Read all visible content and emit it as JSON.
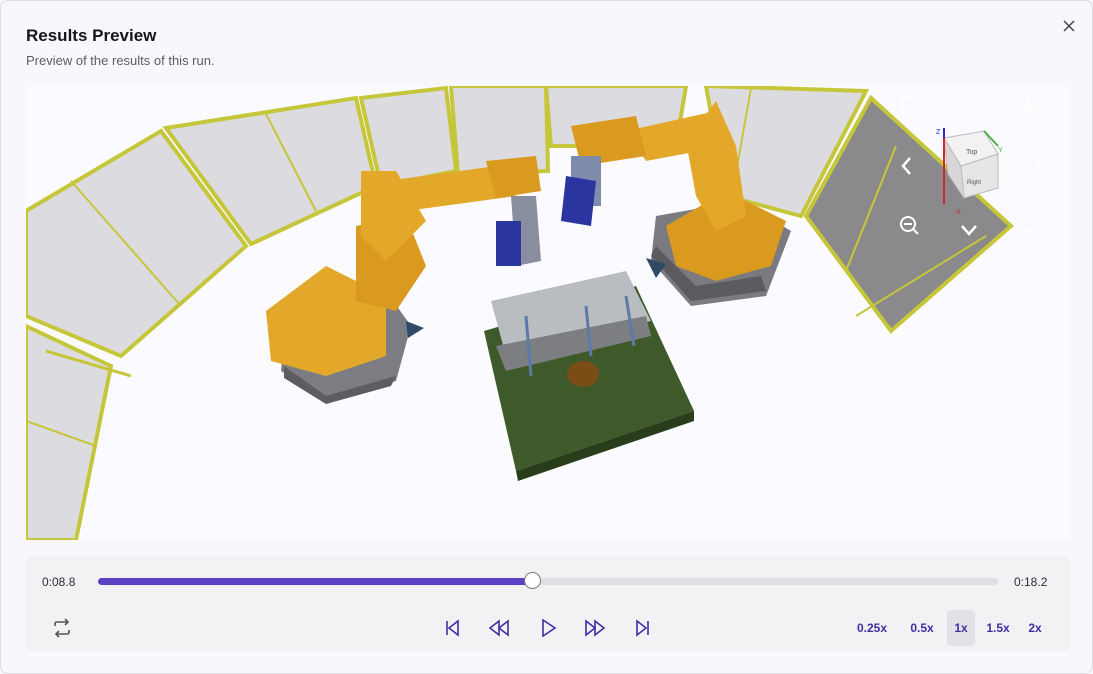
{
  "dialog": {
    "title": "Results Preview",
    "subtitle": "Preview of the results of this run."
  },
  "viewer": {
    "scene": "robot-welding-cell-3d",
    "view_cube": {
      "faces": [
        "Top",
        "Right"
      ],
      "axes": [
        "X",
        "Y",
        "Z"
      ]
    },
    "controls": [
      "camera-icon",
      "chevron-up-icon",
      "move-icon",
      "chevron-left-icon",
      "chevron-right-icon",
      "zoom-out-icon",
      "chevron-down-icon",
      "settings-icon"
    ]
  },
  "playback": {
    "current_time": "0:08.8",
    "total_time": "0:18.2",
    "progress": 0.483,
    "speeds": [
      "0.25x",
      "0.5x",
      "1x",
      "1.5x",
      "2x"
    ],
    "active_speed": "1x"
  },
  "colors": {
    "accent": "#5b3fc4",
    "robot": "#e3a82a",
    "fence": "#c6c63a",
    "table": "#3f5a2a"
  }
}
